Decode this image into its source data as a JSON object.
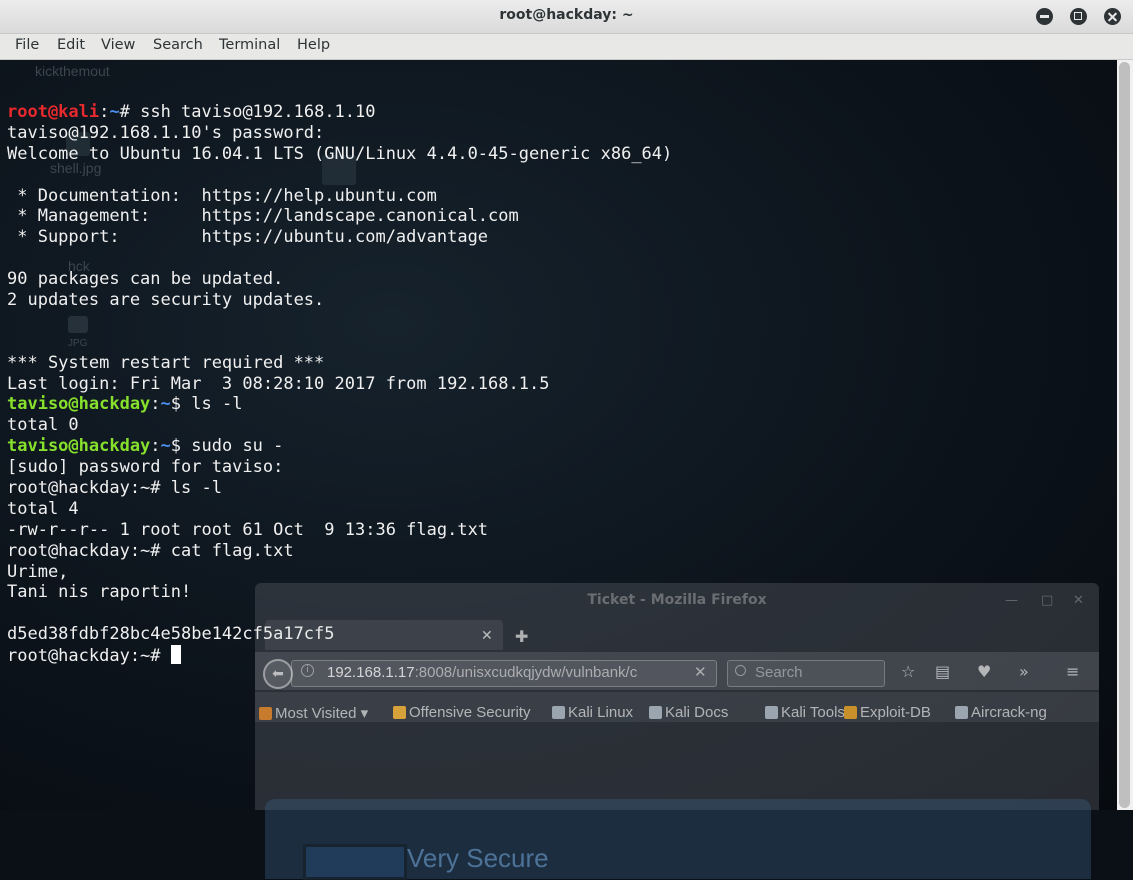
{
  "window": {
    "title": "root@hackday: ~",
    "menu": [
      "File",
      "Edit",
      "View",
      "Search",
      "Terminal",
      "Help"
    ]
  },
  "desktop": {
    "labels": [
      "kickthemout",
      "shell.jpg",
      "hck",
      "JPG"
    ]
  },
  "terminal": {
    "lines": [
      [
        {
          "t": "root@kali",
          "c": "red"
        },
        {
          "t": ":",
          "c": ""
        },
        {
          "t": "~",
          "c": "blu"
        },
        {
          "t": "# ssh taviso@192.168.1.10",
          "c": ""
        }
      ],
      [
        {
          "t": "taviso@192.168.1.10's password:",
          "c": ""
        }
      ],
      [
        {
          "t": "Welcome to Ubuntu 16.04.1 LTS (GNU/Linux 4.4.0-45-generic x86_64)",
          "c": ""
        }
      ],
      [
        {
          "t": "",
          "c": ""
        }
      ],
      [
        {
          "t": " * Documentation:  https://help.ubuntu.com",
          "c": ""
        }
      ],
      [
        {
          "t": " * Management:     https://landscape.canonical.com",
          "c": ""
        }
      ],
      [
        {
          "t": " * Support:        https://ubuntu.com/advantage",
          "c": ""
        }
      ],
      [
        {
          "t": "",
          "c": ""
        }
      ],
      [
        {
          "t": "90 packages can be updated.",
          "c": ""
        }
      ],
      [
        {
          "t": "2 updates are security updates.",
          "c": ""
        }
      ],
      [
        {
          "t": "",
          "c": ""
        }
      ],
      [
        {
          "t": "",
          "c": ""
        }
      ],
      [
        {
          "t": "*** System restart required ***",
          "c": ""
        }
      ],
      [
        {
          "t": "Last login: Fri Mar  3 08:28:10 2017 from 192.168.1.5",
          "c": ""
        }
      ],
      [
        {
          "t": "taviso@hackday",
          "c": "grn"
        },
        {
          "t": ":",
          "c": ""
        },
        {
          "t": "~",
          "c": "blu"
        },
        {
          "t": "$ ls -l",
          "c": ""
        }
      ],
      [
        {
          "t": "total 0",
          "c": ""
        }
      ],
      [
        {
          "t": "taviso@hackday",
          "c": "grn"
        },
        {
          "t": ":",
          "c": ""
        },
        {
          "t": "~",
          "c": "blu"
        },
        {
          "t": "$ sudo su -",
          "c": ""
        }
      ],
      [
        {
          "t": "[sudo] password for taviso:",
          "c": ""
        }
      ],
      [
        {
          "t": "root@hackday:~# ls -l",
          "c": ""
        }
      ],
      [
        {
          "t": "total 4",
          "c": ""
        }
      ],
      [
        {
          "t": "-rw-r--r-- 1 root root 61 Oct  9 13:36 flag.txt",
          "c": ""
        }
      ],
      [
        {
          "t": "root@hackday:~# cat flag.txt",
          "c": ""
        }
      ],
      [
        {
          "t": "Urime,",
          "c": ""
        }
      ],
      [
        {
          "t": "Tani nis raportin!",
          "c": ""
        }
      ],
      [
        {
          "t": "",
          "c": ""
        }
      ],
      [
        {
          "t": "d5ed38fdbf28bc4e58be142cf5a17cf5",
          "c": ""
        }
      ],
      [
        {
          "t": "root@hackday:~# ",
          "c": ""
        },
        {
          "t": "",
          "c": "cursor"
        }
      ]
    ]
  },
  "firefox": {
    "title": "Ticket - Mozilla Firefox",
    "url_host": "192.168.1.17",
    "url_rest": ":8008/unisxcudkqjydw/vulnbank/c",
    "search_placeholder": "Search",
    "bookmarks": [
      {
        "label": "Most Visited ▾",
        "icon": "folder-icon",
        "color": "#c77b2e"
      },
      {
        "label": "Offensive Security",
        "icon": "offsec-icon",
        "color": "#d8a23a"
      },
      {
        "label": "Kali Linux",
        "icon": "kali-icon",
        "color": "#9aa5b0"
      },
      {
        "label": "Kali Docs",
        "icon": "kali-icon",
        "color": "#9aa5b0"
      },
      {
        "label": "Kali Tools",
        "icon": "kali-icon",
        "color": "#9aa5b0"
      },
      {
        "label": "Exploit-DB",
        "icon": "exploitdb-icon",
        "color": "#c8902a"
      },
      {
        "label": "Aircrack-ng",
        "icon": "aircrack-icon",
        "color": "#9aa5b0"
      }
    ],
    "page_title": "Very Secure"
  }
}
